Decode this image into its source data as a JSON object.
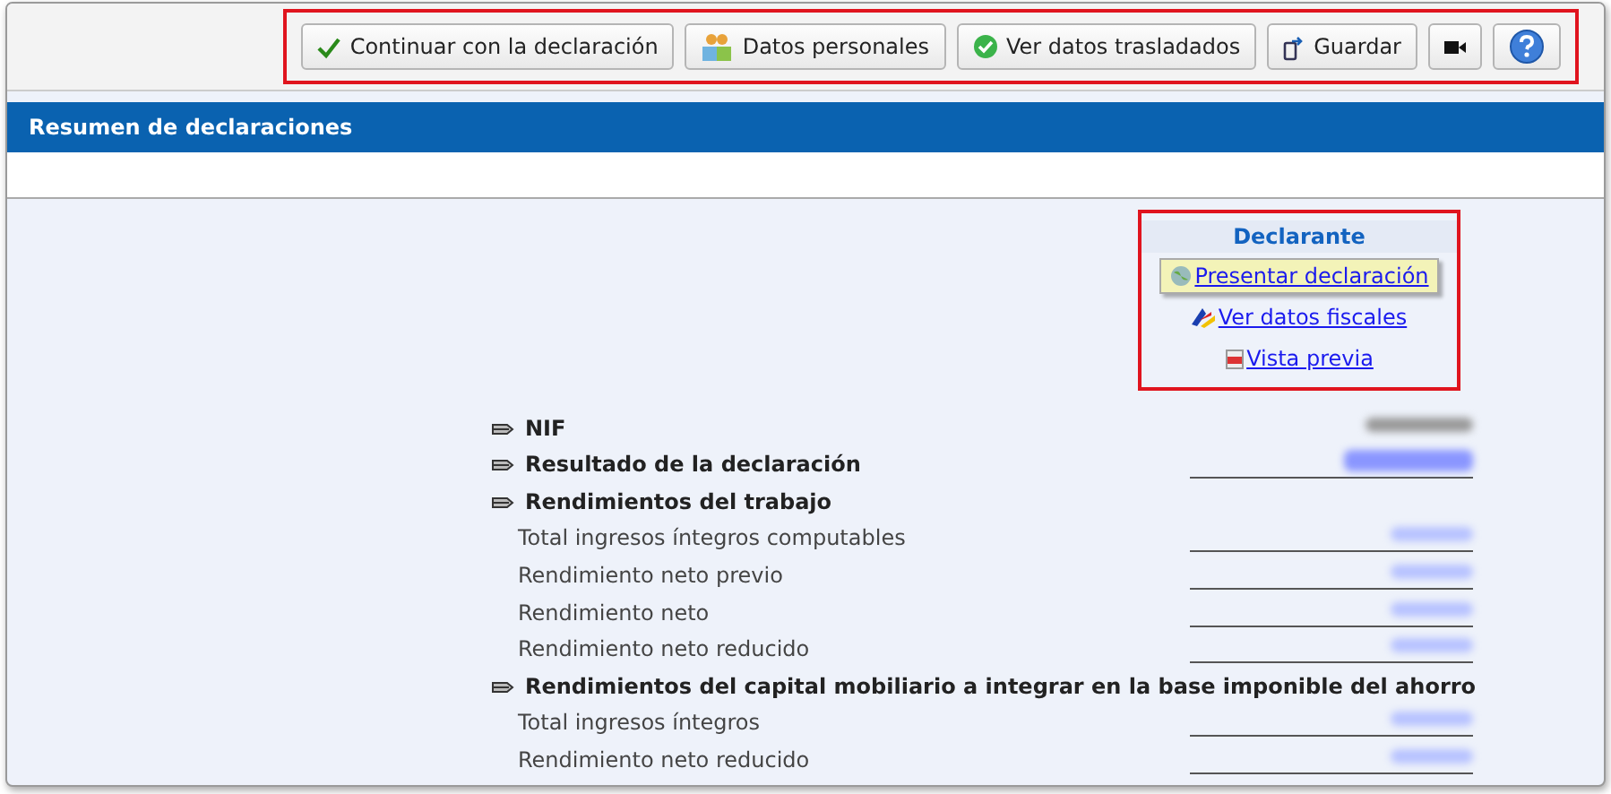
{
  "toolbar": {
    "highlighted": true,
    "buttons": [
      {
        "kind": "continue",
        "label": "Continuar con la declaración"
      },
      {
        "kind": "personal",
        "label": "Datos personales"
      },
      {
        "kind": "transferred",
        "label": "Ver datos trasladados"
      },
      {
        "kind": "save",
        "label": "Guardar"
      },
      {
        "kind": "video"
      },
      {
        "kind": "help"
      }
    ]
  },
  "header": {
    "title": "Resumen de declaraciones"
  },
  "declarante": {
    "highlighted": true,
    "title": "Declarante",
    "links": [
      {
        "kind": "submit",
        "label": "Presentar declaración",
        "hovered": true
      },
      {
        "kind": "fiscal",
        "label": "Ver datos fiscales",
        "hovered": false
      },
      {
        "kind": "preview",
        "label": "Vista previa",
        "hovered": false
      }
    ]
  },
  "rows": [
    {
      "kind": "section",
      "label": "NIF",
      "masked_value": true,
      "underlined": false
    },
    {
      "kind": "section",
      "label": "Resultado de la declaración",
      "masked_value": true,
      "underlined": true
    },
    {
      "kind": "section",
      "label": "Rendimientos del trabajo",
      "masked_value": false,
      "underlined": false
    },
    {
      "kind": "item",
      "label": "Total ingresos íntegros computables",
      "masked_value": true,
      "underlined": true
    },
    {
      "kind": "item",
      "label": "Rendimiento neto previo",
      "masked_value": true,
      "underlined": true
    },
    {
      "kind": "item",
      "label": "Rendimiento neto",
      "masked_value": true,
      "underlined": true
    },
    {
      "kind": "item",
      "label": "Rendimiento neto reducido",
      "masked_value": true,
      "underlined": true
    },
    {
      "kind": "section",
      "label": "Rendimientos del capital mobiliario a integrar en la base imponible del ahorro",
      "masked_value": false,
      "underlined": false
    },
    {
      "kind": "item",
      "label": "Total ingresos íntegros",
      "masked_value": true,
      "underlined": true
    },
    {
      "kind": "item",
      "label": "Rendimiento neto reducido",
      "masked_value": true,
      "underlined": true
    }
  ]
}
